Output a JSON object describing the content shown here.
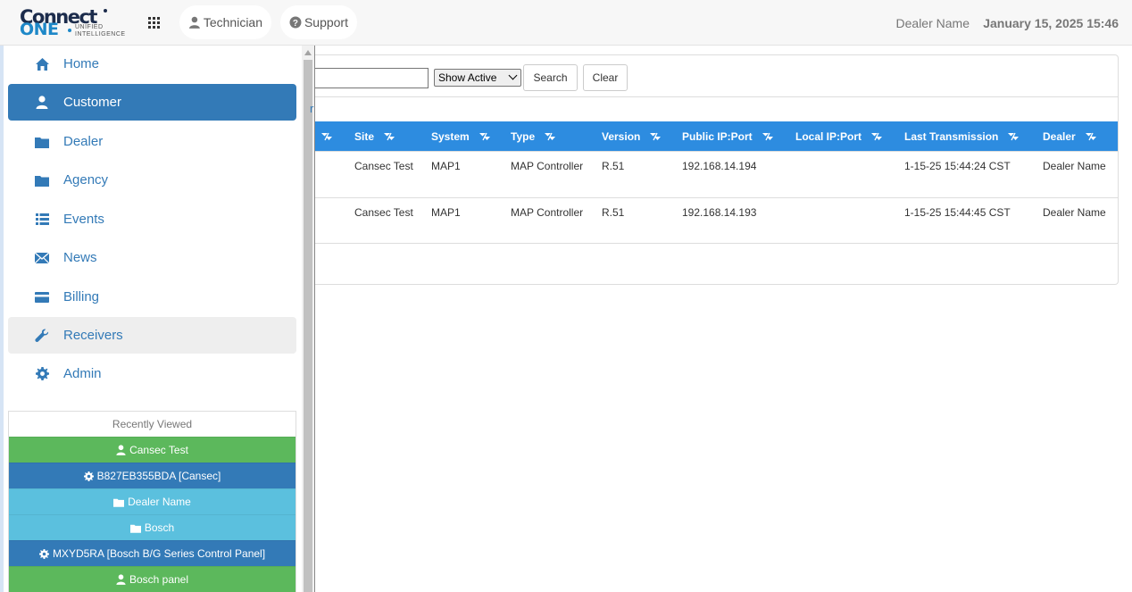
{
  "header": {
    "logo": {
      "connect": "Connect",
      "one": "ONE",
      "tagline_1": "UNIFIED",
      "tagline_2": "INTELLIGENCE"
    },
    "technician_label": "Technician",
    "support_label": "Support",
    "dealer_name": "Dealer Name",
    "datetime": "January 15, 2025 15:46"
  },
  "sidebar": {
    "items": [
      {
        "label": "Home",
        "icon": "home-icon"
      },
      {
        "label": "Customer",
        "icon": "user-icon"
      },
      {
        "label": "Dealer",
        "icon": "folder-icon"
      },
      {
        "label": "Agency",
        "icon": "folder-icon"
      },
      {
        "label": "Events",
        "icon": "list-icon"
      },
      {
        "label": "News",
        "icon": "envelope-icon"
      },
      {
        "label": "Billing",
        "icon": "credit-card-icon"
      },
      {
        "label": "Receivers",
        "icon": "wrench-icon"
      },
      {
        "label": "Admin",
        "icon": "gear-icon"
      }
    ],
    "recent": {
      "title": "Recently Viewed",
      "items": [
        {
          "label": "Cansec Test",
          "icon": "user-icon",
          "color": "#5cb85c"
        },
        {
          "label": "B827EB355BDA [Cansec]",
          "icon": "gear-icon",
          "color": "#337ab7"
        },
        {
          "label": "Dealer Name",
          "icon": "folder-icon",
          "color": "#5bc0de"
        },
        {
          "label": "Bosch",
          "icon": "folder-icon",
          "color": "#5bc0de"
        },
        {
          "label": "MXYD5RA [Bosch B/G Series Control Panel]",
          "icon": "gear-icon",
          "color": "#337ab7"
        },
        {
          "label": "Bosch panel",
          "icon": "user-icon",
          "color": "#5cb85c"
        }
      ]
    }
  },
  "toolbar": {
    "search_value": "",
    "filter_selected": "Show Active",
    "search_label": "Search",
    "clear_label": "Clear",
    "filter_link_fragment": "r"
  },
  "table": {
    "columns": [
      "Site",
      "System",
      "Type",
      "Version",
      "Public IP:Port",
      "Local IP:Port",
      "Last Transmission",
      "Dealer"
    ],
    "rows": [
      {
        "site": "Cansec Test",
        "system": "MAP1",
        "type": "MAP Controller",
        "version": "R.51",
        "public_ip": "192.168.14.194",
        "local_ip": "",
        "last_transmission": "1-15-25 15:44:24 CST",
        "dealer": "Dealer Name"
      },
      {
        "site": "Cansec Test",
        "system": "MAP1",
        "type": "MAP Controller",
        "version": "R.51",
        "public_ip": "192.168.14.193",
        "local_ip": "",
        "last_transmission": "1-15-25 15:44:45 CST",
        "dealer": "Dealer Name"
      }
    ]
  },
  "colors": {
    "primary": "#337ab7",
    "table_header": "#2d8ce0",
    "success": "#5cb85c",
    "info": "#5bc0de"
  }
}
